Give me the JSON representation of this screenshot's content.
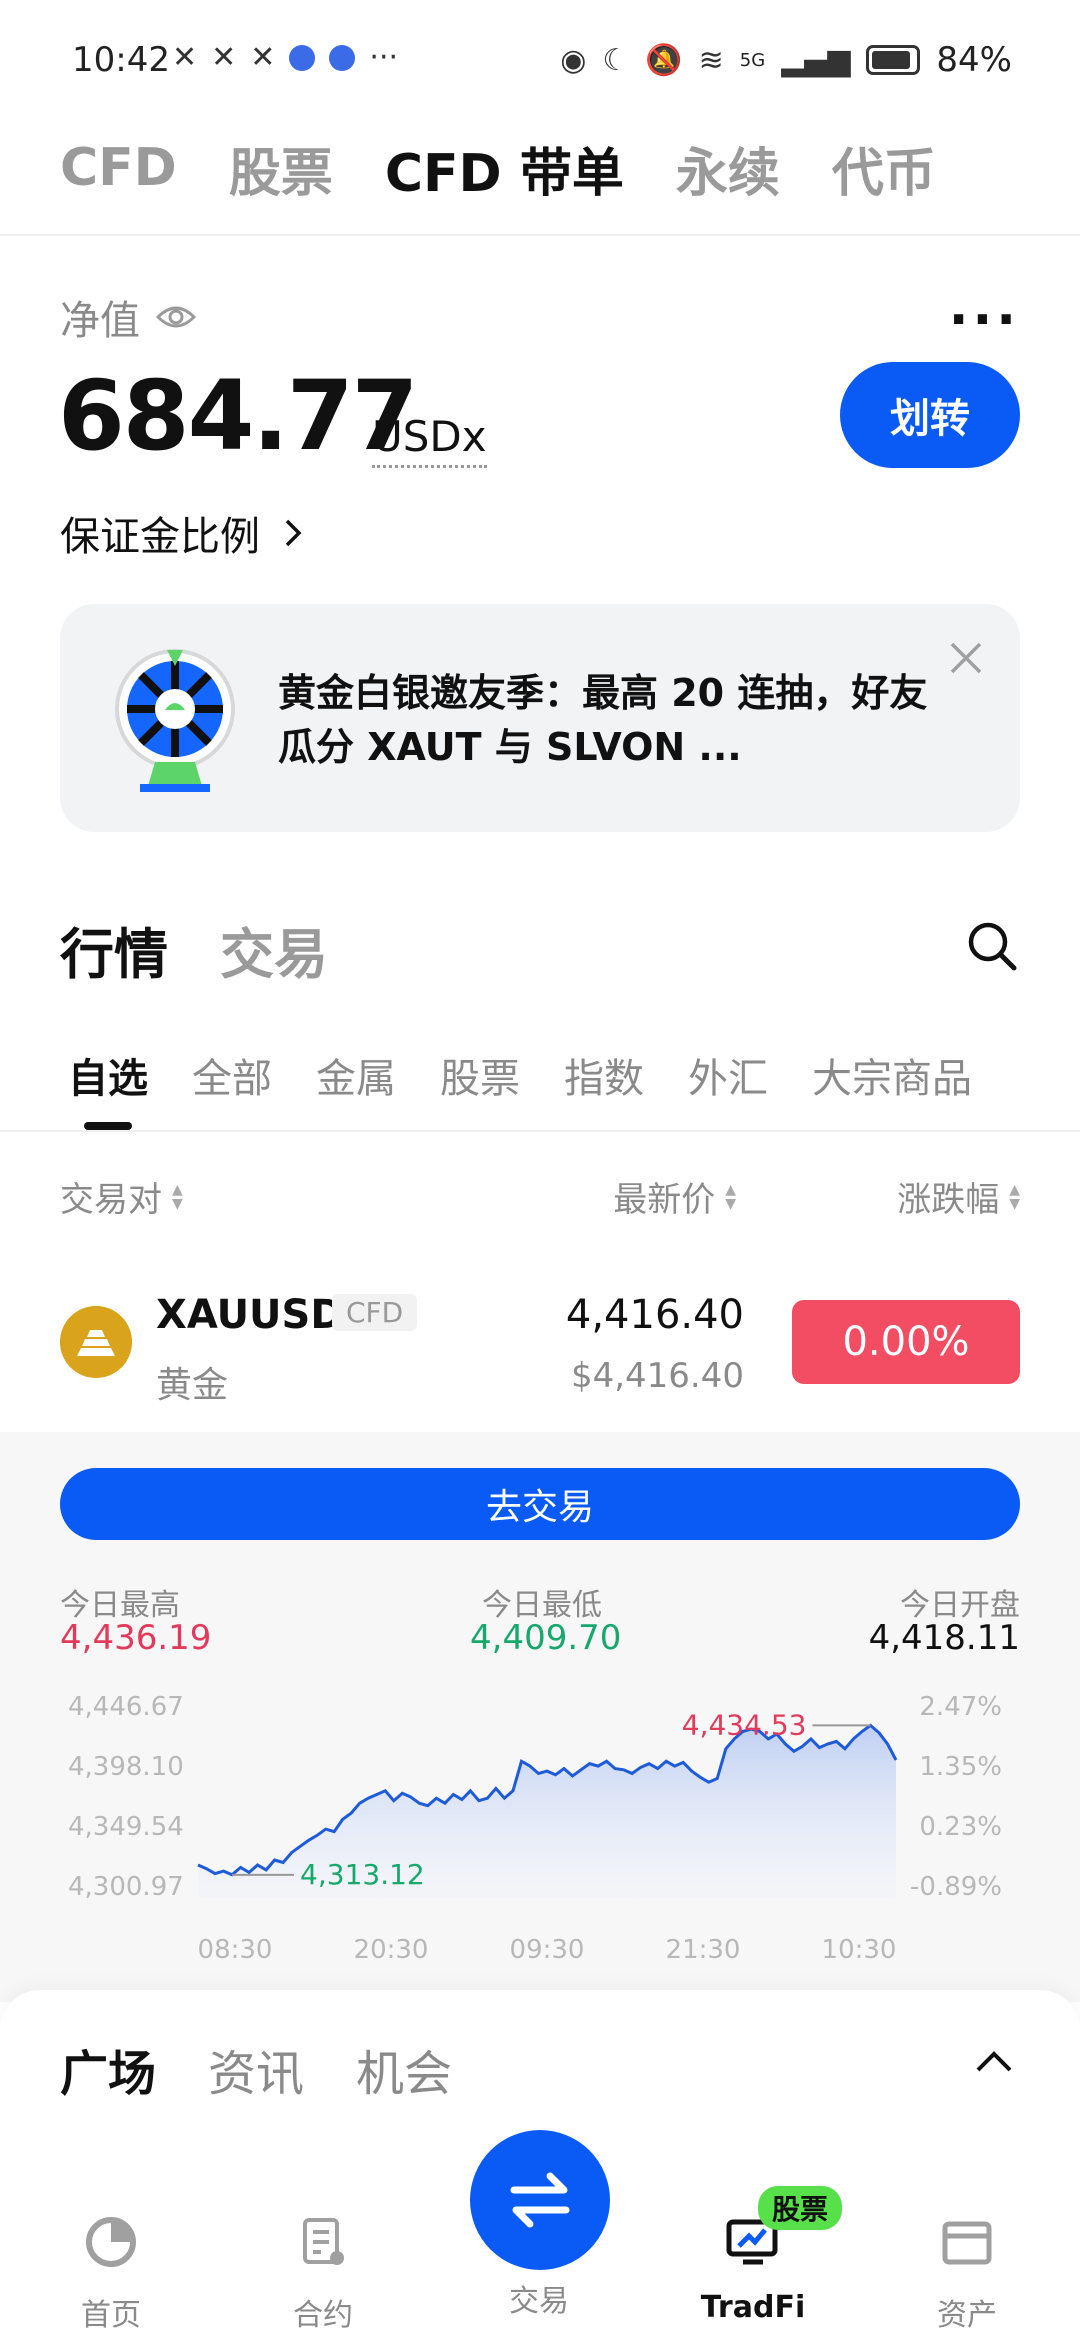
{
  "status_bar": {
    "time": "10:42",
    "signal_label": "5G",
    "battery": "84%"
  },
  "top_tabs": [
    {
      "label": "CFD"
    },
    {
      "label": "股票"
    },
    {
      "label": "CFD 带单"
    },
    {
      "label": "永续"
    },
    {
      "label": "代币"
    }
  ],
  "account": {
    "net_value_label": "净值",
    "net_value": "684.77",
    "unit": "USDx",
    "transfer_label": "划转",
    "margin_ratio_label": "保证金比例"
  },
  "banner": {
    "text": "黄金白银邀友季：最高 20 连抽，好友瓜分 XAUT 与 SLVON ..."
  },
  "market": {
    "section_tabs": [
      {
        "label": "行情"
      },
      {
        "label": "交易"
      }
    ],
    "categories": [
      {
        "label": "自选"
      },
      {
        "label": "全部"
      },
      {
        "label": "金属"
      },
      {
        "label": "股票"
      },
      {
        "label": "指数"
      },
      {
        "label": "外汇"
      },
      {
        "label": "大宗商品"
      }
    ],
    "col_pair": "交易对",
    "col_price": "最新价",
    "col_change": "涨跌幅"
  },
  "row": {
    "symbol": "XAUUSD",
    "tag": "CFD",
    "name": "黄金",
    "price": "4,416.40",
    "price_usd": "$4,416.40",
    "change": "0.00%",
    "change_color": "#f24d63"
  },
  "detail": {
    "trade_button": "去交易",
    "high_label": "今日最高",
    "high": "4,436.19",
    "low_label": "今日最低",
    "low": "4,409.70",
    "open_label": "今日开盘",
    "open": "4,418.11",
    "high_color": "#e23a5a",
    "low_color": "#17a86b"
  },
  "chart_data": {
    "type": "area",
    "y_ticks_left": [
      "4,446.67",
      "4,398.10",
      "4,349.54",
      "4,300.97"
    ],
    "y_ticks_right": [
      "2.47%",
      "1.35%",
      "0.23%",
      "-0.89%"
    ],
    "x_ticks": [
      "08:30",
      "20:30",
      "09:30",
      "21:30",
      "10:30"
    ],
    "ylim": [
      4300.97,
      4446.67
    ],
    "max_label": "4,434.53",
    "min_label": "4,313.12",
    "values": [
      4318,
      4315,
      4311,
      4313,
      4310,
      4316,
      4312,
      4318,
      4314,
      4322,
      4320,
      4328,
      4333,
      4338,
      4342,
      4347,
      4345,
      4355,
      4360,
      4368,
      4372,
      4375,
      4378,
      4370,
      4376,
      4373,
      4368,
      4366,
      4372,
      4368,
      4375,
      4371,
      4378,
      4370,
      4372,
      4380,
      4372,
      4378,
      4402,
      4398,
      4392,
      4394,
      4391,
      4396,
      4390,
      4395,
      4400,
      4398,
      4402,
      4396,
      4395,
      4392,
      4397,
      4400,
      4396,
      4402,
      4398,
      4401,
      4394,
      4389,
      4385,
      4388,
      4412,
      4420,
      4426,
      4428,
      4426,
      4420,
      4424,
      4416,
      4410,
      4414,
      4420,
      4413,
      4416,
      4418,
      4412,
      4420,
      4426,
      4431,
      4425,
      4416,
      4403
    ],
    "line_color": "#1e5bd8"
  },
  "sheet": {
    "tabs": [
      {
        "label": "广场"
      },
      {
        "label": "资讯"
      },
      {
        "label": "机会"
      }
    ]
  },
  "bottom_nav": [
    {
      "label": "首页"
    },
    {
      "label": "合约"
    },
    {
      "label": "交易"
    },
    {
      "label": "TradFi"
    },
    {
      "label": "资产"
    }
  ],
  "nav_badge": "股票"
}
